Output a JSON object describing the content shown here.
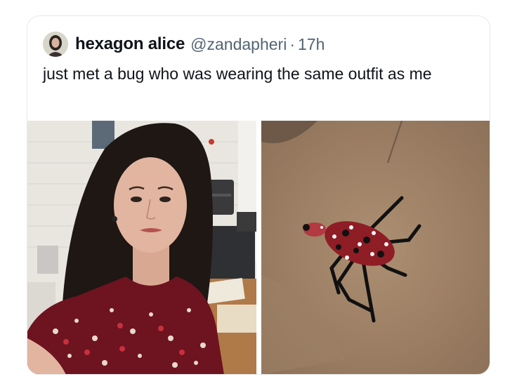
{
  "tweet": {
    "author_name": "hexagon alice",
    "author_handle": "@zandapheri",
    "separator": "·",
    "time_ago": "17h",
    "text": "just met a bug who was wearing the same outfit as me"
  },
  "media": {
    "left_photo": "woman-selfie-red-patterned-dress",
    "right_photo": "spotted-lanternfly-on-floor"
  }
}
